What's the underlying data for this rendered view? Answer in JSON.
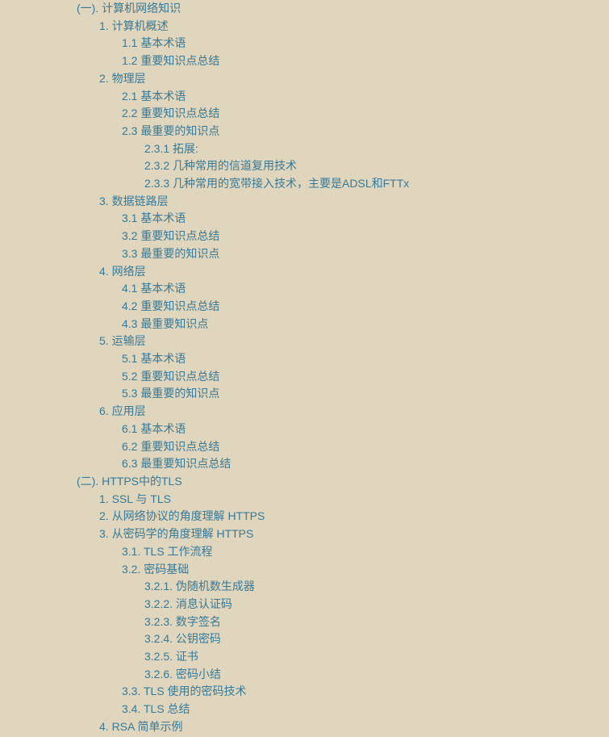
{
  "toc": [
    {
      "label": "(一). 计算机网络知识",
      "children": [
        {
          "label": "1. 计算机概述",
          "children": [
            {
              "label": "1.1 基本术语"
            },
            {
              "label": "1.2 重要知识点总结"
            }
          ]
        },
        {
          "label": "2. 物理层",
          "children": [
            {
              "label": "2.1 基本术语"
            },
            {
              "label": "2.2 重要知识点总结"
            },
            {
              "label": "2.3 最重要的知识点",
              "children": [
                {
                  "label": "2.3.1 拓展:"
                },
                {
                  "label": "2.3.2 几种常用的信道复用技术"
                },
                {
                  "label": "2.3.3 几种常用的宽带接入技术，主要是ADSL和FTTx"
                }
              ]
            }
          ]
        },
        {
          "label": "3. 数据链路层",
          "children": [
            {
              "label": "3.1 基本术语"
            },
            {
              "label": "3.2 重要知识点总结"
            },
            {
              "label": "3.3 最重要的知识点"
            }
          ]
        },
        {
          "label": "4. 网络层",
          "children": [
            {
              "label": "4.1 基本术语"
            },
            {
              "label": "4.2 重要知识点总结"
            },
            {
              "label": "4.3 最重要知识点"
            }
          ]
        },
        {
          "label": "5. 运输层",
          "children": [
            {
              "label": "5.1 基本术语"
            },
            {
              "label": "5.2 重要知识点总结"
            },
            {
              "label": "5.3 最重要的知识点"
            }
          ]
        },
        {
          "label": "6. 应用层",
          "children": [
            {
              "label": "6.1 基本术语"
            },
            {
              "label": "6.2 重要知识点总结"
            },
            {
              "label": "6.3 最重要知识点总结"
            }
          ]
        }
      ]
    },
    {
      "label": "(二). HTTPS中的TLS",
      "children": [
        {
          "label": "1. SSL 与 TLS"
        },
        {
          "label": "2. 从网络协议的角度理解 HTTPS"
        },
        {
          "label": "3. 从密码学的角度理解 HTTPS",
          "children": [
            {
              "label": "3.1. TLS 工作流程"
            },
            {
              "label": "3.2. 密码基础",
              "children": [
                {
                  "label": "3.2.1. 伪随机数生成器"
                },
                {
                  "label": "3.2.2. 消息认证码"
                },
                {
                  "label": "3.2.3. 数字签名"
                },
                {
                  "label": "3.2.4. 公钥密码"
                },
                {
                  "label": "3.2.5. 证书"
                },
                {
                  "label": "3.2.6. 密码小结"
                }
              ]
            },
            {
              "label": "3.3. TLS 使用的密码技术"
            },
            {
              "label": "3.4. TLS 总结"
            }
          ]
        },
        {
          "label": "4. RSA 简单示例"
        }
      ]
    }
  ]
}
